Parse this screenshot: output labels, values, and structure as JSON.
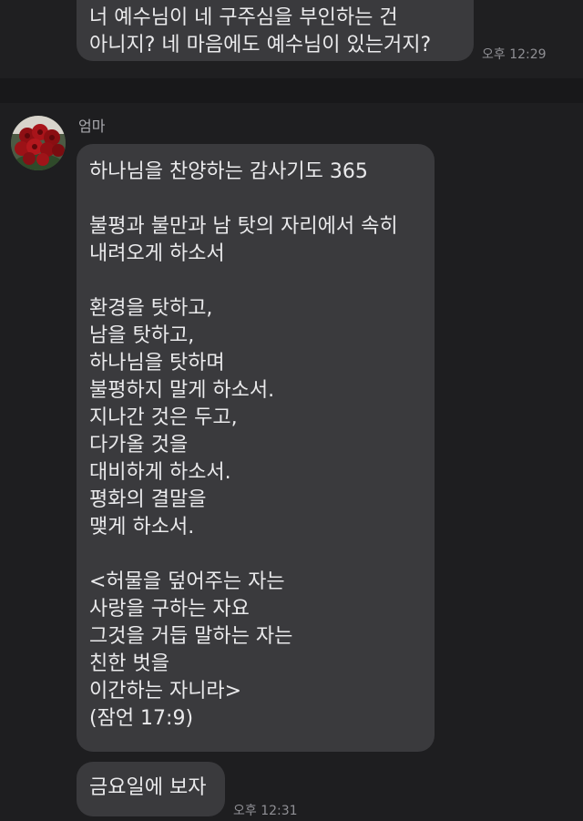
{
  "previous_message": {
    "text": "너 예수님이 네 구주심을 부인하는 건\n아니지? 네 마음에도 예수님이 있는거지?",
    "time": "오후 12:29"
  },
  "incoming": {
    "sender_name": "엄마",
    "avatar_icon": "red-roses-avatar-icon",
    "prayer_message": "하나님을 찬양하는 감사기도 365\n\n불평과 불만과 남 탓의 자리에서 속히\n내려오게 하소서\n\n환경을 탓하고,\n남을 탓하고,\n하나님을 탓하며\n불평하지 말게 하소서.\n지나간 것은 두고,\n다가올 것을\n대비하게 하소서.\n평화의 결말을\n맺게 하소서.\n\n<허물을 덮어주는 자는\n사랑을 구하는 자요\n그것을 거듭 말하는 자는\n친한 벗을\n이간하는 자니라>\n(잠언 17:9)",
    "short_message": "금요일에 보자",
    "time": "오후 12:31"
  },
  "colors": {
    "background": "#1e1e20",
    "bubble": "#3a3a3d",
    "divider": "#18181a",
    "time_text": "#8f8f94"
  }
}
